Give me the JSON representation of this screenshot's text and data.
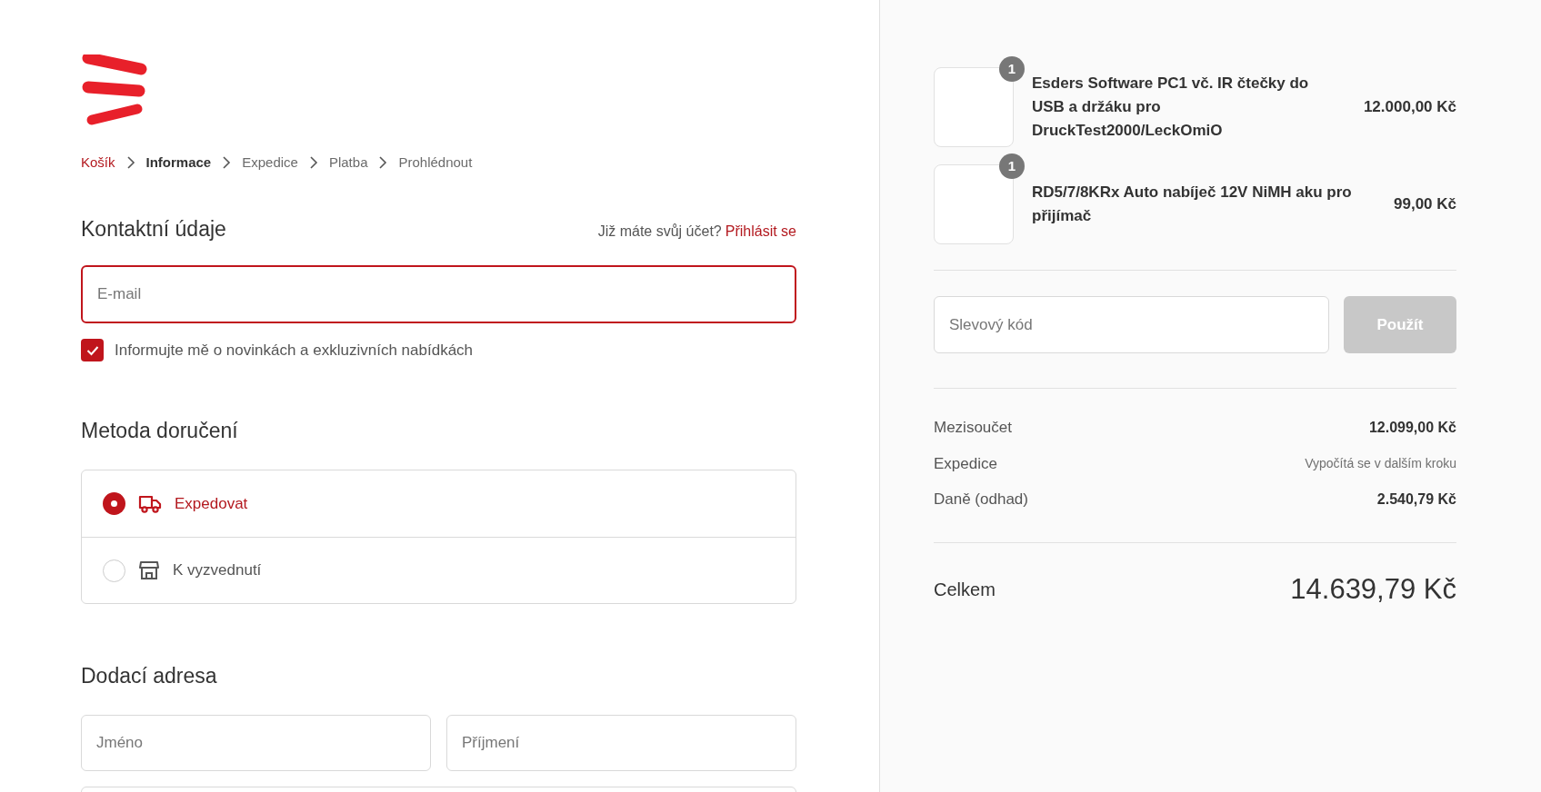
{
  "breadcrumb": [
    {
      "label": "Košík",
      "kind": "link"
    },
    {
      "label": "Informace",
      "kind": "current"
    },
    {
      "label": "Expedice",
      "kind": "upcoming"
    },
    {
      "label": "Platba",
      "kind": "upcoming"
    },
    {
      "label": "Prohlédnout",
      "kind": "upcoming"
    }
  ],
  "contact": {
    "title": "Kontaktní údaje",
    "account_prompt": "Již máte svůj účet?",
    "login_link": "Přihlásit se",
    "email": {
      "placeholder": "E-mail",
      "focused": true
    },
    "newsletter": {
      "label": "Informujte mě o novinkách a exkluzivních nabídkách",
      "checked": true
    }
  },
  "delivery": {
    "title": "Metoda doručení",
    "options": [
      {
        "label": "Expedovat",
        "kind": "ship",
        "selected": true
      },
      {
        "label": "K vyzvednutí",
        "kind": "pickup",
        "selected": false
      }
    ]
  },
  "address": {
    "title": "Dodací adresa",
    "fields": [
      {
        "placeholder": "Jméno"
      },
      {
        "placeholder": "Příjmení"
      }
    ]
  },
  "cart": {
    "items": [
      {
        "name": "Esders Software PC1 vč. IR čtečky do USB a držáku pro DruckTest2000/LeckOmiO",
        "quantity": "1",
        "price": "12.000,00 Kč"
      },
      {
        "name": "RD5/7/8KRx Auto nabíječ 12V NiMH aku pro přijímač",
        "quantity": "1",
        "price": "99,00 Kč"
      }
    ],
    "discount": {
      "placeholder": "Slevový kód",
      "button": "Použít",
      "disabled": true
    },
    "summary": [
      {
        "label": "Mezisoučet",
        "value": "12.099,00 Kč",
        "kind": "amount"
      },
      {
        "label": "Expedice",
        "value": "Vypočítá se v dalším kroku",
        "kind": "note"
      },
      {
        "label": "Daně (odhad)",
        "value": "2.540,79 Kč",
        "kind": "amount"
      }
    ],
    "total": {
      "label": "Celkem",
      "value": "14.639,79 Kč"
    }
  }
}
